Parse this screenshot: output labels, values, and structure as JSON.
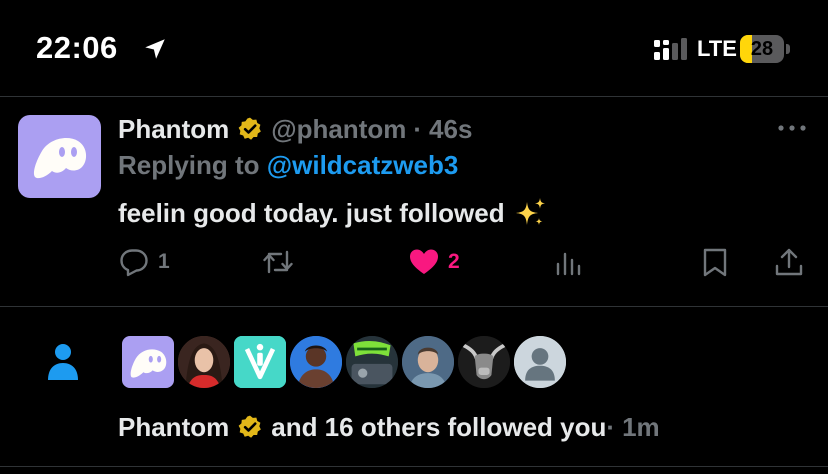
{
  "status_bar": {
    "time": "22:06",
    "network": "LTE",
    "battery": "28",
    "battery_level": 0.28
  },
  "tweet": {
    "author_name": "Phantom",
    "handle": "@phantom",
    "separator": "·",
    "age": "46s",
    "replying_prefix": "Replying to ",
    "replying_handle": "@wildcatzweb3",
    "text": "feelin good today. just followed",
    "actions": {
      "reply_count": "1",
      "repost_count": "",
      "like_count": "2"
    },
    "colors": {
      "accent_blue": "#1d9bf0",
      "like_pink": "#f91880",
      "verified_gold": "#e2b719",
      "phantom_purple": "#ab9ff2"
    }
  },
  "notification": {
    "name": "Phantom",
    "rest": " and 16 others followed you ",
    "separator": "·",
    "age": "1m",
    "avatars": [
      "phantom-logo",
      "woman-red-top",
      "teal-logo",
      "man-blue-bg",
      "stay-focused-badge",
      "man-selfie",
      "bull-artwork",
      "default-avatar"
    ]
  }
}
